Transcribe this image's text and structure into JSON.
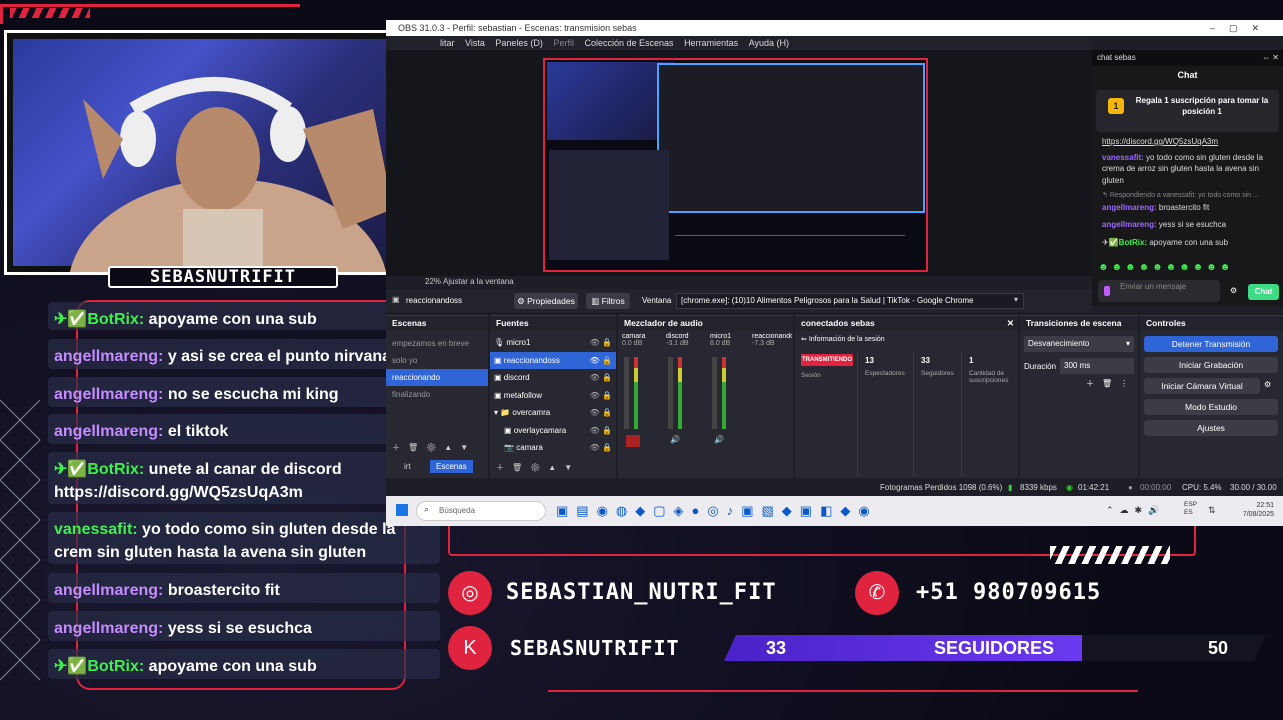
{
  "webcam": {
    "name_label": "SEBASNUTRIFIT"
  },
  "chat_overlay": [
    {
      "user": "BotRix:",
      "kind": "bot",
      "text": "apoyame con una sub"
    },
    {
      "user": "angellmareng:",
      "kind": "user",
      "text": "y asi se crea el punto nirvana"
    },
    {
      "user": "angellmareng:",
      "kind": "user",
      "text": "no se escucha mi king"
    },
    {
      "user": "angellmareng:",
      "kind": "user",
      "text": "el tiktok"
    },
    {
      "user": "BotRix:",
      "kind": "bot",
      "text": "unete al canar de discord https://discord.gg/WQ5zsUqA3m"
    },
    {
      "user": "vanessafit:",
      "kind": "van",
      "text": "yo todo como sin gluten desde la crem sin gluten hasta la avena sin gluten"
    },
    {
      "user": "angellmareng:",
      "kind": "user",
      "text": "broastercito fit"
    },
    {
      "user": "angellmareng:",
      "kind": "user",
      "text": "yess si se esuchca"
    },
    {
      "user": "BotRix:",
      "kind": "bot",
      "text": "apoyame con una sub"
    }
  ],
  "obs": {
    "title": "OBS 31.0.3 - Perfil: sebastian - Escenas: transmision sebas",
    "menu": [
      "litar",
      "Vista",
      "Paneles (D)",
      "Perfil",
      "Colección de Escenas",
      "Herramientas",
      "Ayuda (H)"
    ],
    "toolbar": {
      "source_name": "reaccionandoss",
      "props_label": "Propiedades",
      "filters_label": "Filtros",
      "window_label": "Ventana",
      "window_value": "[chrome.exe]: (10)10 Alimentos Peligrosos para la Salud | TikTok - Google Chrome",
      "adjust_label": "Ajustar a la ventana",
      "zoom_value": "22%"
    },
    "scenes": {
      "title": "Escenas",
      "items": [
        "empezamos en breve",
        "solo yo",
        "reaccionando",
        "finalizando"
      ],
      "tab": "Escenas",
      "tab2": "irt"
    },
    "sources": {
      "title": "Fuentes",
      "items": [
        "micro1",
        "reaccionandoss",
        "discord",
        "metafollow",
        "overcamra",
        "overlaycamara",
        "camara"
      ]
    },
    "mixer": {
      "title": "Mezclador de audio",
      "channels": [
        {
          "name": "camara",
          "db": "0.0 dB"
        },
        {
          "name": "discord",
          "db": "-3.1 dB"
        },
        {
          "name": "micro1",
          "db": "8.0 dB"
        },
        {
          "name": "reaccionando",
          "db": "-7.3 dB"
        }
      ]
    },
    "connected": {
      "title": "conectados sebas",
      "info_label": "Información de la sesión",
      "status_badge": "TRANSMITIENDO",
      "stats": [
        {
          "value": "",
          "label": "Sesión"
        },
        {
          "value": "13",
          "label": "Espectadores"
        },
        {
          "value": "33",
          "label": "Seguidores"
        },
        {
          "value": "1",
          "label": "Cantidad de suscripciones"
        }
      ]
    },
    "transitions": {
      "title": "Transiciones de escena",
      "value": "Desvanecimiento",
      "duration_label": "Duración",
      "duration_value": "300 ms"
    },
    "controls": {
      "title": "Controles",
      "buttons": [
        "Detener Transmisión",
        "Iniciar Grabación",
        "Iniciar Cámara Virtual",
        "Modo Estudio",
        "Ajustes"
      ]
    },
    "status": {
      "dropped": "Fotogramas Perdidos 1098 (0.6%)",
      "bitrate": "8339 kbps",
      "stream_time": "01:42:21",
      "rec_time": "00:00:00",
      "cpu": "CPU: 5.4%",
      "fps": "30.00 / 30.00 FPS"
    }
  },
  "side_chat": {
    "window_title": "chat sebas",
    "title": "Chat",
    "pinned": "Regala 1 suscripción para tomar la posición 1",
    "messages": [
      {
        "user": "",
        "text": "https://discord.gg/WQ5zsUqA3m"
      },
      {
        "user": "vanessafit:",
        "text": "yo todo como sin gluten desde la crema de arroz sin gluten hasta la avena sin gluten"
      },
      {
        "user": "",
        "text": "Respondiendo a vanessafit: yo todo como sin ..."
      },
      {
        "user": "angellmareng:",
        "text": "broastercito fit"
      },
      {
        "user": "angellmareng:",
        "text": "yess si se esuchca"
      },
      {
        "user": "BotRix:",
        "text": "apoyame con una sub"
      }
    ],
    "input_placeholder": "Enviar un mensaje",
    "send_label": "Chat"
  },
  "taskbar": {
    "search_placeholder": "Búsqueda",
    "lang": "ESP ES",
    "time": "22:51",
    "date": "7/08/2025"
  },
  "overlay_info": {
    "instagram": "SEBASTIAN_NUTRI_FIT",
    "phone": "+51 980709615",
    "kick": "SEBASNUTRIFIT",
    "followers_current": "33",
    "followers_label": "SEGUIDORES",
    "followers_goal": "50",
    "followers_progress": 0.66
  },
  "colors": {
    "accent_red": "#e0243f",
    "bar_purple": "#5b2cd8",
    "obs_blue": "#2f65d7",
    "twitch_purple": "#9146ff"
  }
}
